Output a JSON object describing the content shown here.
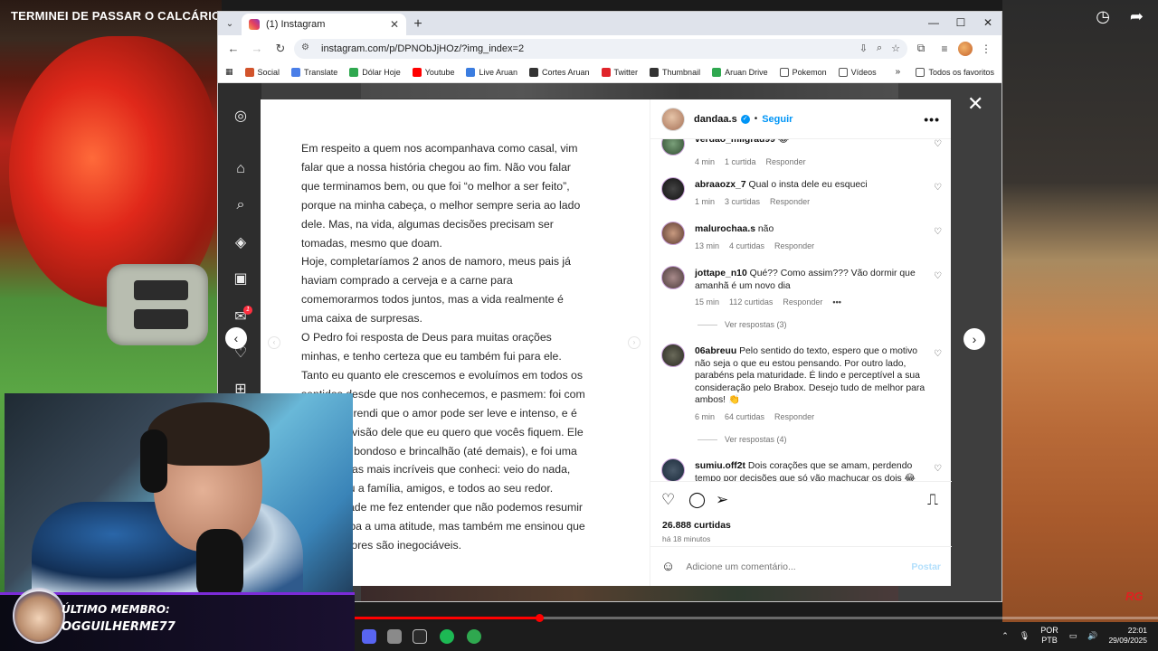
{
  "stream": {
    "title": "TERMINEI DE PASSAR O CALCÁRIO NA",
    "icons": [
      "clock-icon",
      "share-icon"
    ],
    "member_label": "ÚLTIMO MEMBRO:",
    "member_name": "OGGUILHERME77",
    "progress": 0.23
  },
  "browser": {
    "tab_title": "(1) Instagram",
    "url": "instagram.com/p/DPNObJjHOz/?img_index=2",
    "bookmarks": [
      {
        "label": "Social",
        "color": "#d2542c"
      },
      {
        "label": "Translate",
        "color": "#4a7ee8"
      },
      {
        "label": "Dólar Hoje",
        "color": "#2fa84f"
      },
      {
        "label": "Youtube",
        "color": "#ff0000"
      },
      {
        "label": "Live Aruan",
        "color": "#3b7de0"
      },
      {
        "label": "Cortes Aruan",
        "color": "#333333"
      },
      {
        "label": "Twitter",
        "color": "#e0242a"
      },
      {
        "label": "Thumbnail",
        "color": "#333333"
      },
      {
        "label": "Aruan Drive",
        "color": "#2fa84f"
      },
      {
        "label": "Pokemon",
        "color": "#555555"
      },
      {
        "label": "Vídeos",
        "color": "#555555"
      }
    ],
    "all_bookmarks": "Todos os favoritos"
  },
  "instagram": {
    "notification_count": "1",
    "post_lines": [
      "Em respeito a quem nos acompanhava como casal, vim",
      "falar que a nossa história chegou ao fim. Não vou falar",
      "que terminamos bem, ou que foi “o melhor a ser feito”,",
      "porque na minha cabeça, o melhor sempre seria ao lado",
      "dele. Mas, na vida, algumas decisões precisam ser",
      "tomadas, mesmo que doam.",
      "Hoje, completaríamos 2 anos de namoro, meus pais já",
      "haviam comprado a cerveja e a carne para",
      "comemorarmos todos juntos, mas a vida realmente é",
      "uma caixa de surpresas.",
      "O Pedro foi resposta de Deus para muitas orações",
      "minhas, e tenho certeza que eu também fui para ele.",
      "Tanto eu quanto ele crescemos e evoluímos em todos os",
      "sentidos desde que nos conhecemos, e pasmem: foi com",
      "ele que aprendi que o amor pode ser leve e intenso, e é",
      "com essa visão dele que eu quero que vocês fiquem. Ele",
      "é um cara bondoso e brincalhão (até demais), e foi uma",
      "das pessoas mais incríveis que conheci: veio do nada,",
      "conquistou a família, amigos, e todos ao seu redor.",
      "A maturidade me fez entender que não podemos resumir",
      "uma pessoa a uma atitude, mas também me ensinou que",
      "alguns valores são inegociáveis."
    ],
    "author": "dandaa.s",
    "follow_label": "Seguir",
    "comments": [
      {
        "user": "verdao_milgrau99",
        "text": "😂",
        "time": "4 min",
        "likes": "1 curtida",
        "reply": "Responder"
      },
      {
        "user": "abraaozx_7",
        "text": "Qual o insta dele eu esqueci",
        "time": "1 min",
        "likes": "3 curtidas",
        "reply": "Responder"
      },
      {
        "user": "malurochaa.s",
        "text": "não",
        "time": "13 min",
        "likes": "4 curtidas",
        "reply": "Responder"
      },
      {
        "user": "jottape_n10",
        "text": "Qué?? Como assim??? Vão dormir que amanhã é um novo dia",
        "time": "15 min",
        "likes": "112 curtidas",
        "reply": "Responder",
        "view_replies": "Ver respostas (3)"
      },
      {
        "user": "06abreuu",
        "text": "Pelo sentido do texto, espero que o motivo não seja o que eu estou pensando. Por outro lado, parabéns pela maturidade. É lindo e perceptível a sua consideração pelo Brabox. Desejo tudo de melhor para ambos! 👏",
        "time": "6 min",
        "likes": "64 curtidas",
        "reply": "Responder",
        "view_replies": "Ver respostas (4)"
      },
      {
        "user": "sumiu.off2t",
        "text": "Dois corações que se amam, perdendo tempo por decisões que só vão machucar os dois 😂",
        "time": "",
        "likes": "",
        "reply": ""
      }
    ],
    "likes_total": "26.888 curtidas",
    "posted_ago": "há 18 minutos",
    "comment_placeholder": "Adicione um comentário...",
    "post_button": "Postar"
  },
  "taskbar": {
    "lang_1": "POR",
    "lang_2": "PTB",
    "time": "22:01",
    "date": "29/09/2025"
  },
  "watermark": "RG"
}
